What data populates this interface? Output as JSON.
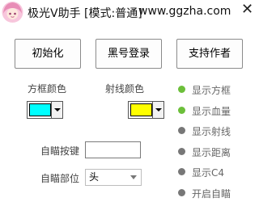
{
  "window": {
    "title": "极光V助手 [模式:普通]",
    "site": "www.ggzha.com",
    "close_glyph": "✕"
  },
  "buttons": {
    "init": "初始化",
    "blacklist_login": "黑号登录",
    "support_author": "支持作者"
  },
  "colors": {
    "box_color_label": "方框颜色",
    "box_color_value": "#00ffff",
    "ray_color_label": "射线颜色",
    "ray_color_value": "#ffff00"
  },
  "aim": {
    "hotkey_label": "自瞄按键",
    "hotkey_value": "",
    "part_label": "自瞄部位",
    "part_selected": "头"
  },
  "status": {
    "on_color": "#6cbf3a",
    "off_color": "#777777",
    "items": [
      {
        "label": "显示方框",
        "active": true
      },
      {
        "label": "显示血量",
        "active": true
      },
      {
        "label": "显示射线",
        "active": false
      },
      {
        "label": "显示距离",
        "active": false
      },
      {
        "label": "显示C4",
        "active": false
      },
      {
        "label": "开启自瞄",
        "active": false
      }
    ]
  }
}
